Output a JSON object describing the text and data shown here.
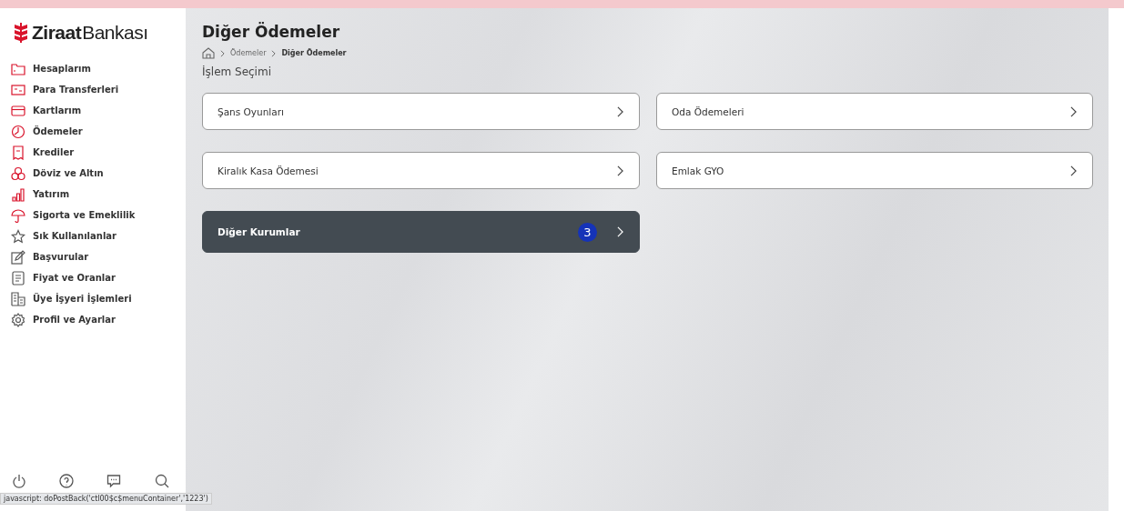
{
  "logo": {
    "bold": "Ziraat",
    "light": "Bankası"
  },
  "sidebar": {
    "items": [
      {
        "label": "Hesaplarım"
      },
      {
        "label": "Para Transferleri"
      },
      {
        "label": "Kartlarım"
      },
      {
        "label": "Ödemeler"
      },
      {
        "label": "Krediler"
      },
      {
        "label": "Döviz ve Altın"
      },
      {
        "label": "Yatırım"
      },
      {
        "label": "Sigorta ve Emeklilik"
      },
      {
        "label": "Sık Kullanılanlar"
      },
      {
        "label": "Başvurular"
      },
      {
        "label": "Fiyat ve Oranlar"
      },
      {
        "label": "Üye İşyeri İşlemleri"
      },
      {
        "label": "Profil ve Ayarlar"
      }
    ]
  },
  "page": {
    "title": "Diğer Ödemeler",
    "breadcrumb": [
      "Ödemeler",
      "Diğer Ödemeler"
    ],
    "section": "İşlem Seçimi"
  },
  "options": [
    {
      "label": "Şans Oyunları",
      "selected": false
    },
    {
      "label": "Oda Ödemeleri",
      "selected": false
    },
    {
      "label": "Kiralık Kasa Ödemesi",
      "selected": false
    },
    {
      "label": "Emlak GYO",
      "selected": false
    },
    {
      "label": "Diğer Kurumlar",
      "selected": true,
      "badge": "3"
    }
  ],
  "status_bar": {
    "text": "javascript: doPostBack('ctl00$c$menuContainer','1223')"
  }
}
